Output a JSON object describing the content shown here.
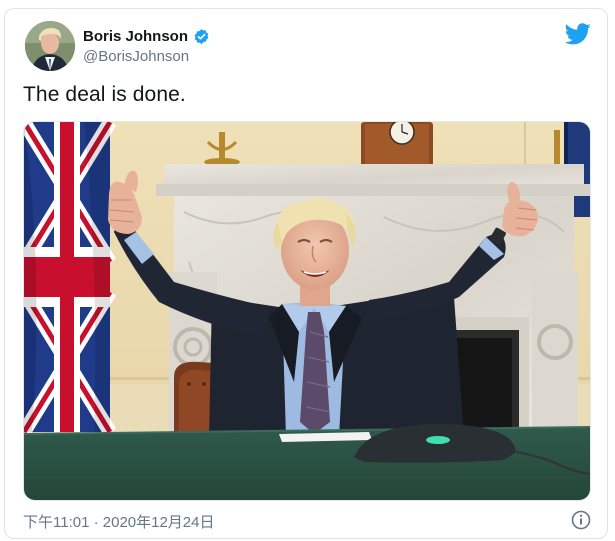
{
  "tweet": {
    "display_name": "Boris Johnson",
    "handle": "@BorisJohnson",
    "text": "The deal is done.",
    "timestamp": "下午11:01 · 2020年12月24日"
  },
  "icons": {
    "verified": "verified-badge-icon",
    "logo": "twitter-bird-icon",
    "info": "info-icon"
  },
  "colors": {
    "accent": "#1da1f2",
    "text": "#14171a",
    "muted": "#657786"
  }
}
